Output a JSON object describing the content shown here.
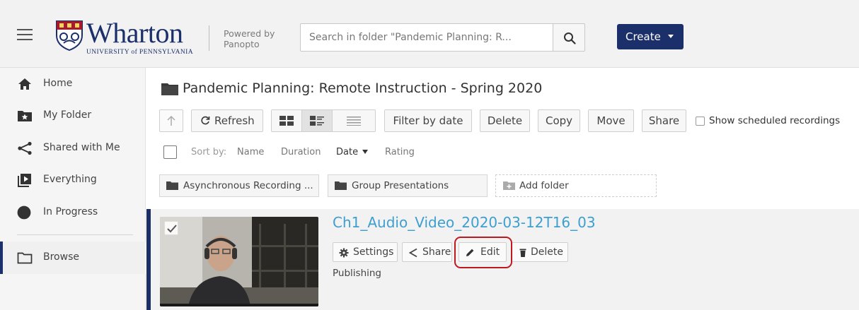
{
  "header": {
    "logo_word": "Wharton",
    "logo_sub": "UNIVERSITY of PENNSYLVANIA",
    "powered_line1": "Powered by",
    "powered_line2": "Panopto",
    "search_placeholder": "Search in folder \"Pandemic Planning: R...",
    "create_label": "Create",
    "brand_color": "#1b2f6b"
  },
  "sidebar": {
    "items": [
      {
        "label": "Home",
        "icon": "home-icon"
      },
      {
        "label": "My Folder",
        "icon": "star-folder-icon"
      },
      {
        "label": "Shared with Me",
        "icon": "share-icon"
      },
      {
        "label": "Everything",
        "icon": "play-stack-icon"
      },
      {
        "label": "In Progress",
        "icon": "half-circle-icon"
      },
      {
        "label": "Browse",
        "icon": "folder-outline-icon",
        "active": true
      }
    ]
  },
  "main": {
    "folder_title": "Pandemic Planning: Remote Instruction - Spring 2020",
    "toolbar": {
      "refresh": "Refresh",
      "filter_by_date": "Filter by date",
      "delete": "Delete",
      "copy": "Copy",
      "move": "Move",
      "share": "Share",
      "show_scheduled": "Show scheduled recordings"
    },
    "sort": {
      "label": "Sort by:",
      "options": [
        "Name",
        "Duration",
        "Date",
        "Rating"
      ],
      "active": "Date"
    },
    "folders": [
      {
        "label": "Asynchronous Recording ..."
      },
      {
        "label": "Group Presentations"
      }
    ],
    "add_folder": "Add folder",
    "session": {
      "title": "Ch1_Audio_Video_2020-03-12T16_03",
      "actions": {
        "settings": "Settings",
        "share": "Share",
        "edit": "Edit",
        "delete": "Delete"
      },
      "status": "Publishing",
      "highlight_color": "#c0181f"
    }
  }
}
